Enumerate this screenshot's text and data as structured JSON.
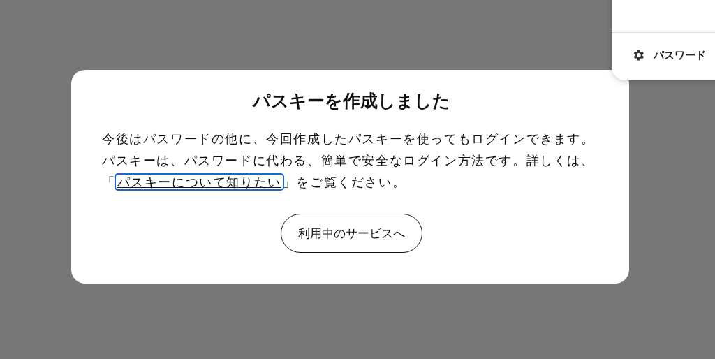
{
  "menu_popup": {
    "items": [
      {
        "label": "パスワード",
        "kind": "settings"
      }
    ]
  },
  "dialog": {
    "title": "パスキーを作成しました",
    "body_before": "今後はパスワードの他に、今回作成したパスキーを使ってもログインできます。パスキーは、パスワードに代わる、簡単で安全なログイン方法です。詳しくは、「",
    "link": {
      "label": "パスキーについて知りたい",
      "focused": true
    },
    "body_after": "」をご覧ください。",
    "button": "利用中のサービスへ"
  }
}
